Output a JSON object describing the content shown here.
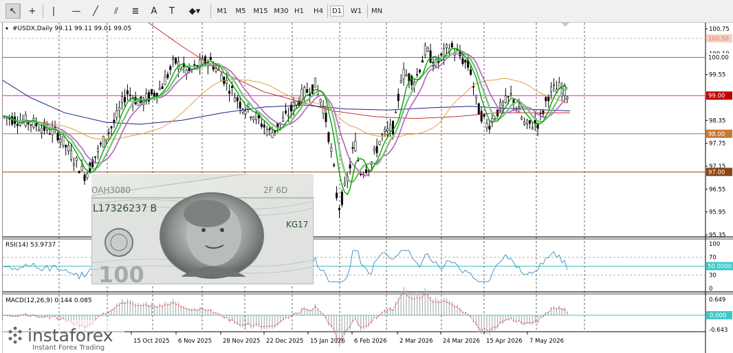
{
  "toolbar": {
    "tools": [
      {
        "name": "cursor-icon",
        "glyph": "↖"
      },
      {
        "name": "crosshair-icon",
        "glyph": "+"
      },
      {
        "name": "vertical-line-icon",
        "glyph": "|"
      },
      {
        "name": "horizontal-line-icon",
        "glyph": "—"
      },
      {
        "name": "trendline-icon",
        "glyph": "╱"
      },
      {
        "name": "channel-icon",
        "glyph": "⫽"
      },
      {
        "name": "fibonacci-icon",
        "glyph": "≣"
      },
      {
        "name": "text-icon",
        "glyph": "A"
      },
      {
        "name": "text-label-icon",
        "glyph": "T"
      },
      {
        "name": "shapes-menu-icon",
        "glyph": "◆▾"
      }
    ],
    "timeframes": [
      "M1",
      "M5",
      "M15",
      "M30",
      "H1",
      "H4",
      "D1",
      "W1",
      "MN"
    ]
  },
  "chart": {
    "header": "#USDX,Daily  99.11 99.11 99.01 99.05",
    "price_labels": [
      "100.75",
      "100.10",
      "99.55",
      "98.95",
      "98.35",
      "97.75",
      "97.15",
      "96.55",
      "95.95",
      "95.35"
    ],
    "level_tags": [
      {
        "text": "100.50",
        "bg": "#f3d3c8",
        "fg": "#e07a5f"
      },
      {
        "text": "100.00",
        "bg": "#ffffff",
        "fg": "#000000",
        "line": "#e020c0"
      },
      {
        "text": "99.00",
        "bg": "#c00000",
        "fg": "#ffffff",
        "line": "#e020c0"
      },
      {
        "text": "98.00",
        "bg": "#c87832",
        "fg": "#ffffff",
        "line": "#b07040"
      },
      {
        "text": "97.00",
        "bg": "#8b4513",
        "fg": "#ffffff",
        "line": "#8b4513"
      }
    ],
    "dates": [
      "15 Oct 2025",
      "6 Nov 2025",
      "28 Nov 2025",
      "22 Dec 2025",
      "15 Jan 2026",
      "6 Feb 2026",
      "2 Mar 2026",
      "24 Mar 2026",
      "15 Apr 2026",
      "7 May 2026"
    ],
    "colors": {
      "candle": "#000000",
      "ma_fast": "#00a000",
      "ma_slow": "#80c080",
      "ma_purple": "#b060c0",
      "ma_orange": "#e0a040",
      "ma_red": "#c03030",
      "ma_navy": "#202080"
    }
  },
  "rsi": {
    "header": "RSI(14) 53.9737",
    "labels": [
      "100",
      "70",
      "30",
      "0"
    ],
    "level_tag": "50.0000"
  },
  "macd": {
    "header": "MACD(12,26,9) 0.144 0.085",
    "labels": [
      "0.649",
      "-0.643"
    ],
    "zero_tag": "0.000"
  },
  "watermark": {
    "brand": "instaforex",
    "tagline": "Instant Forex Trading"
  },
  "chart_data": {
    "type": "line",
    "symbol": "#USDX",
    "timeframe": "Daily",
    "ohlc_last": {
      "open": 99.11,
      "high": 99.11,
      "low": 99.01,
      "close": 99.05
    },
    "x": [
      "15 Oct 2025",
      "6 Nov 2025",
      "28 Nov 2025",
      "22 Dec 2025",
      "15 Jan 2026",
      "6 Feb 2026",
      "2 Mar 2026",
      "24 Mar 2026",
      "15 Apr 2026",
      "7 May 2026"
    ],
    "series": [
      {
        "values": [
          98.4,
          99.8,
          99.3,
          98.3,
          99.2,
          97.0,
          99.6,
          100.0,
          98.4,
          99.1
        ]
      }
    ],
    "levels": [
      100.5,
      100.0,
      99.0,
      98.0,
      97.0
    ],
    "ylim": [
      95.2,
      100.9
    ],
    "rsi": {
      "value": 53.9737,
      "levels": [
        70,
        50,
        30
      ]
    },
    "macd": {
      "main": 0.144,
      "signal": 0.085,
      "ylim": [
        -0.643,
        0.649
      ]
    }
  }
}
